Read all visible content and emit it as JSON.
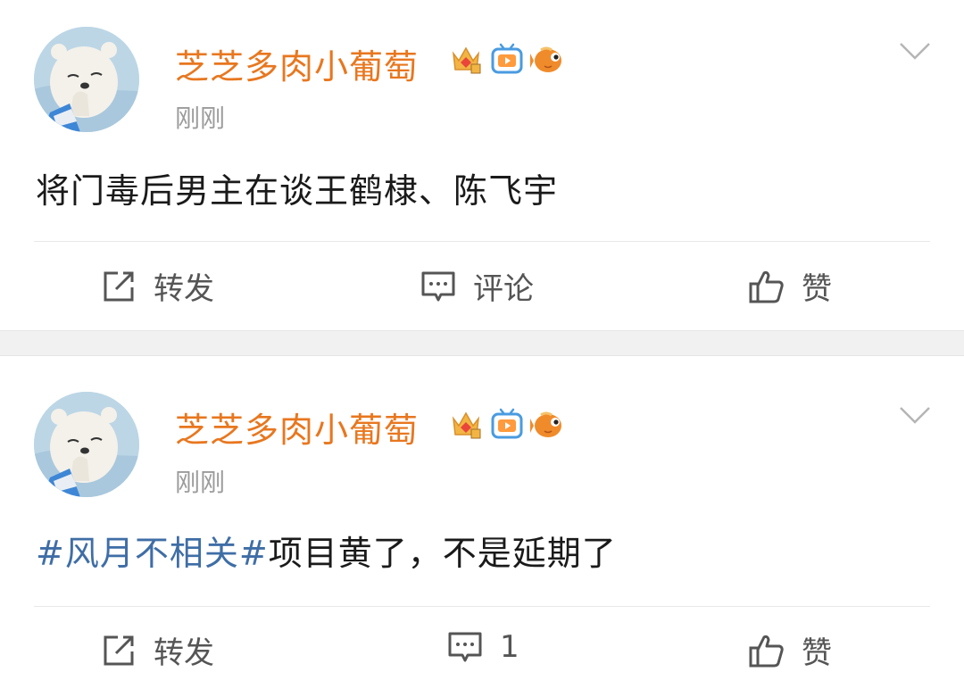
{
  "posts": [
    {
      "author": {
        "name": "芝芝多肉小葡萄",
        "badges": [
          "crown-badge-icon",
          "tv-badge-icon",
          "goldfish-badge-icon"
        ]
      },
      "time": "刚刚",
      "content": {
        "hashtag": "",
        "text": "将门毒后男主在谈王鹤棣、陈飞宇"
      },
      "actions": {
        "repost": "转发",
        "comment": "评论",
        "like": "赞"
      }
    },
    {
      "author": {
        "name": "芝芝多肉小葡萄",
        "badges": [
          "crown-badge-icon",
          "tv-badge-icon",
          "goldfish-badge-icon"
        ]
      },
      "time": "刚刚",
      "content": {
        "hashtag": "#风月不相关#",
        "text": "项目黄了，不是延期了"
      },
      "actions": {
        "repost": "转发",
        "comment": "1",
        "like": "赞"
      }
    }
  ],
  "colors": {
    "username": "#e8771f",
    "hashtag": "#3f6ea6",
    "text": "#1a1a1a",
    "meta": "#9b9b9b",
    "separator": "#f1f1f1"
  }
}
